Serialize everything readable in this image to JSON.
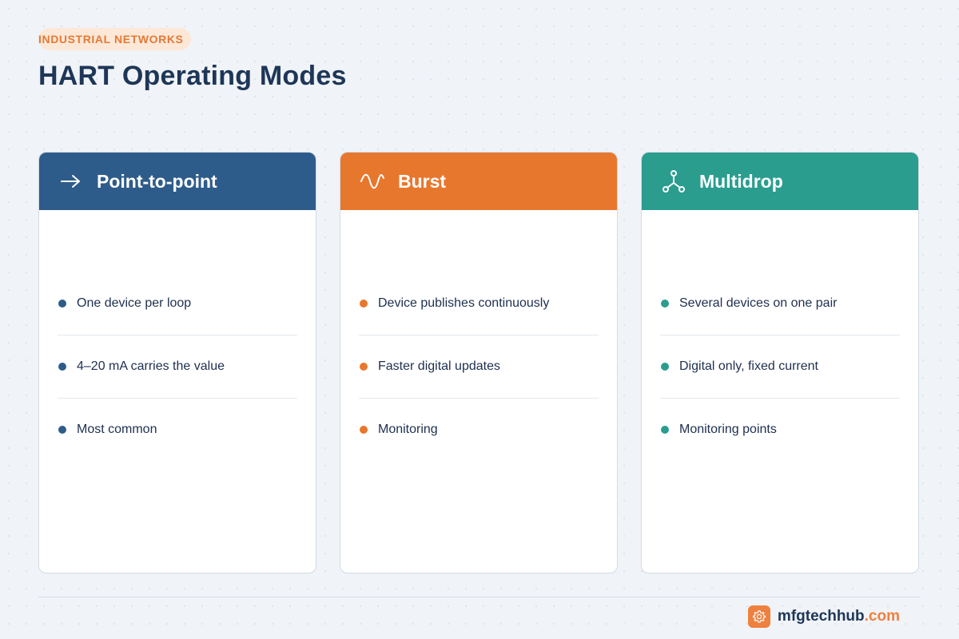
{
  "header": {
    "eyebrow": "INDUSTRIAL NETWORKS",
    "title": "HART Operating Modes"
  },
  "cards": [
    {
      "title": "Point-to-point",
      "icon": "arrow-right-icon",
      "color": "#2e5c8a",
      "items": [
        "One device per loop",
        "4–20 mA carries the value",
        "Most common"
      ]
    },
    {
      "title": "Burst",
      "icon": "sine-wave-icon",
      "color": "#e8772e",
      "items": [
        "Device publishes continuously",
        "Faster digital updates",
        "Monitoring"
      ]
    },
    {
      "title": "Multidrop",
      "icon": "network-branch-icon",
      "color": "#2a9d8f",
      "items": [
        "Several devices on one pair",
        "Digital only, fixed current",
        "Monitoring points"
      ]
    }
  ],
  "footer": {
    "brand_name": "mfgtechhub",
    "brand_tld": ".com",
    "logo_icon": "gear-icon",
    "accent": "#ee8040"
  }
}
